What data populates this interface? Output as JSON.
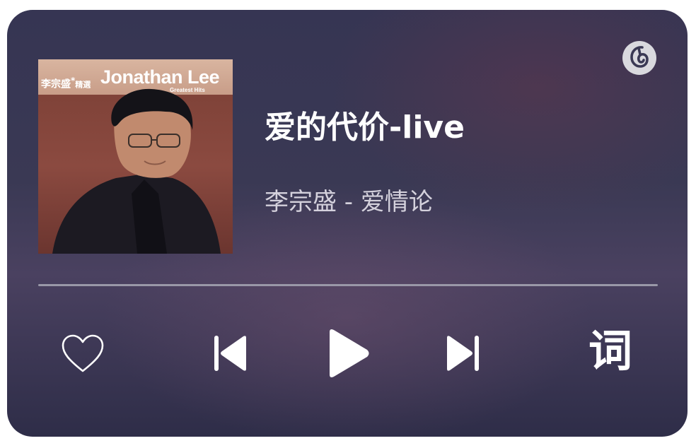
{
  "card": {
    "cover": {
      "artist_cn": "李宗盛",
      "series_cn": "精選",
      "artist_en": "Jonathan Lee",
      "subtitle": "Greatest Hits"
    },
    "song": {
      "title": "爱的代价-live",
      "artist_album": "李宗盛 - 爱情论"
    },
    "progress": 0,
    "controls": {
      "like_icon": "heart-outline-icon",
      "prev_icon": "skip-previous-icon",
      "play_icon": "play-icon",
      "next_icon": "skip-next-icon",
      "lyrics_label": "词"
    },
    "brand_icon": "netease-music-logo-icon",
    "colors": {
      "background_top": "#363553",
      "text_primary": "#ffffff",
      "text_secondary": "#d4d1dc",
      "track": "#9a98a8"
    }
  }
}
